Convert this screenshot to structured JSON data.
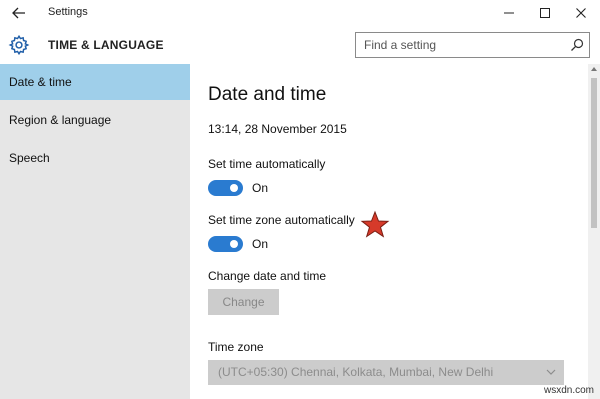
{
  "window": {
    "title": "Settings",
    "back_icon": "back-arrow-icon",
    "minimize_icon": "minimize-icon",
    "maximize_icon": "maximize-icon",
    "close_icon": "close-icon"
  },
  "header": {
    "section_title": "TIME & LANGUAGE",
    "section_icon": "gear-icon",
    "search_placeholder": "Find a setting",
    "search_icon": "search-icon"
  },
  "sidebar": {
    "items": [
      {
        "label": "Date & time",
        "active": true
      },
      {
        "label": "Region & language",
        "active": false
      },
      {
        "label": "Speech",
        "active": false
      }
    ]
  },
  "main": {
    "title": "Date and time",
    "current_datetime": "13:14, 28 November 2015",
    "set_time_auto": {
      "label": "Set time automatically",
      "state": "On"
    },
    "set_timezone_auto": {
      "label": "Set time zone automatically",
      "state": "On"
    },
    "change_section_label": "Change date and time",
    "change_button_label": "Change",
    "timezone_label": "Time zone",
    "timezone_value": "(UTC+05:30) Chennai, Kolkata, Mumbai, New Delhi"
  },
  "annotation": {
    "icon": "red-star-icon"
  },
  "watermark": "wsxdn.com",
  "colors": {
    "accent": "#2a7bd0",
    "sidebar_active": "#9fcfea",
    "sidebar_bg": "#e6e6e6",
    "disabled_bg": "#cccccc",
    "star": "#d63a2a"
  }
}
